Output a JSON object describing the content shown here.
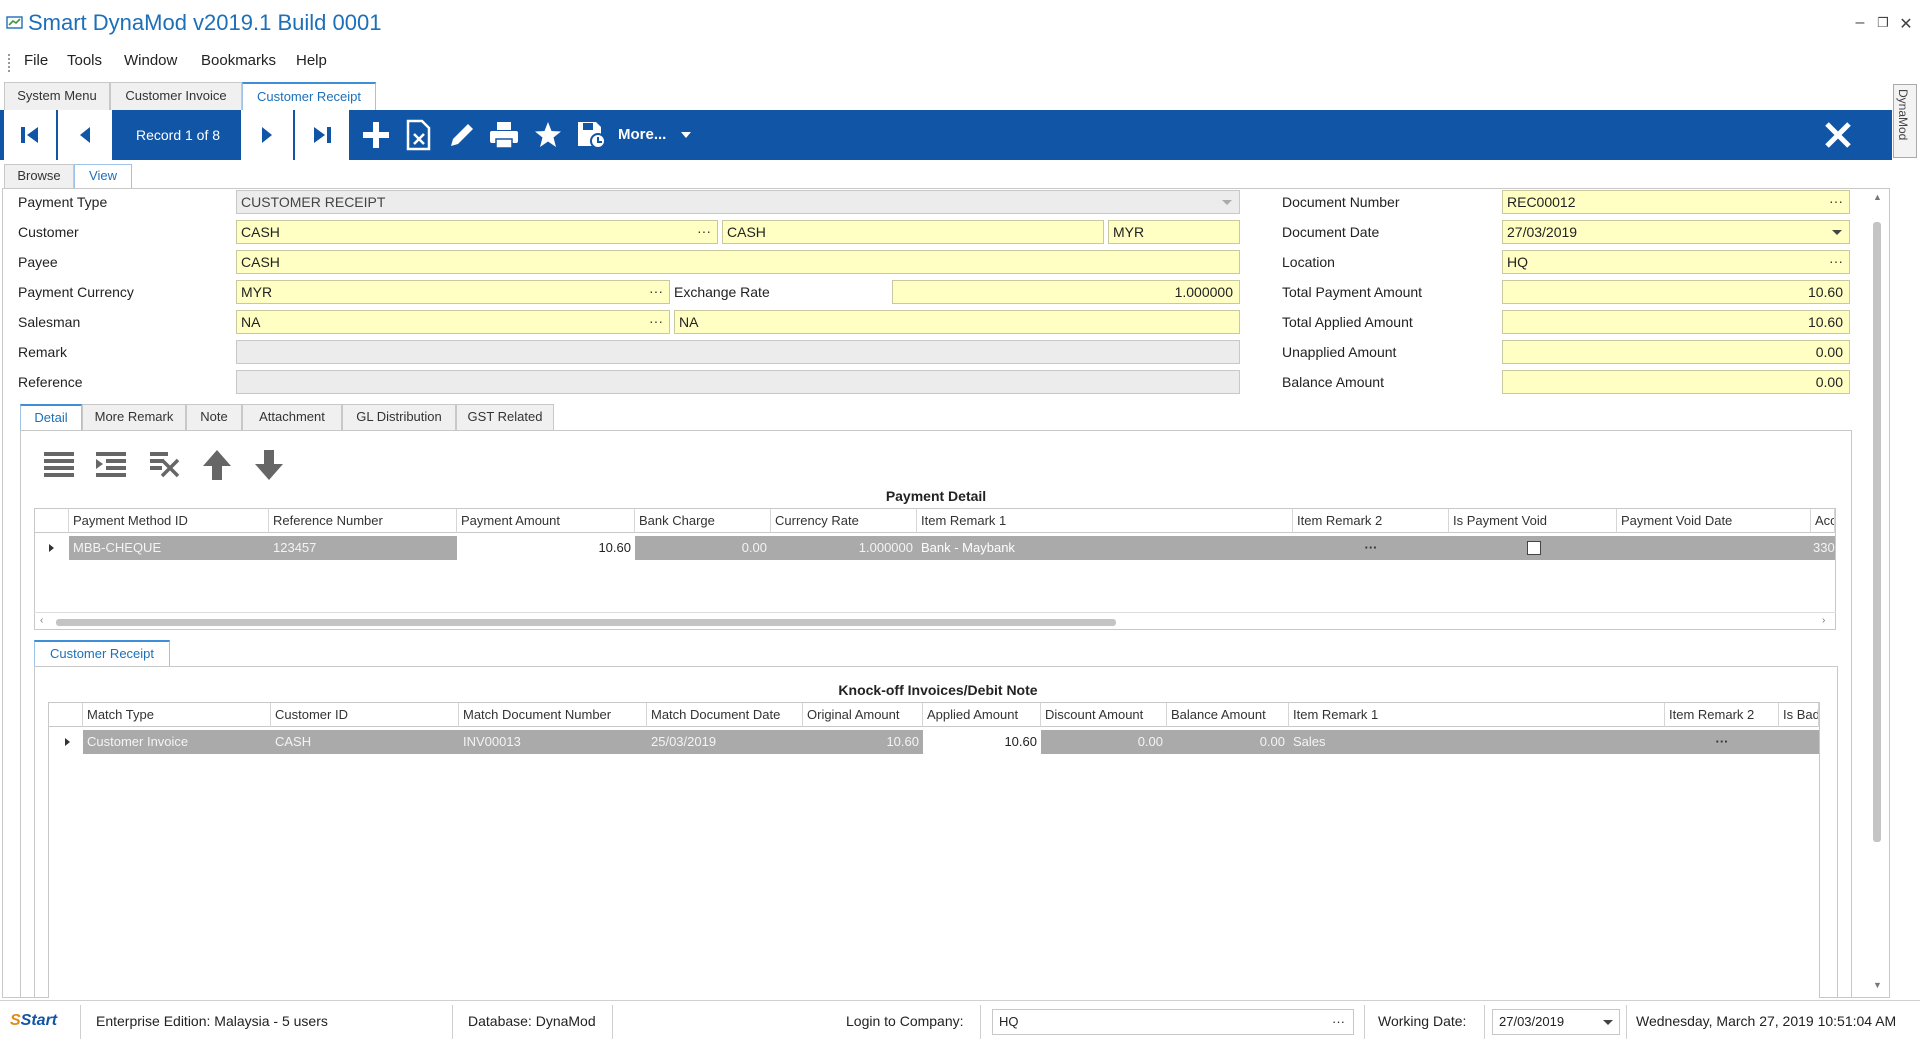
{
  "app": {
    "title": "Smart DynaMod v2019.1 Build 0001",
    "window_controls": [
      "–",
      "❐",
      "✕"
    ]
  },
  "menu": [
    "File",
    "Tools",
    "Window",
    "Bookmarks",
    "Help"
  ],
  "doc_tabs": [
    "System Menu",
    "Customer Invoice",
    "Customer Receipt"
  ],
  "side_tab": "DynaMod",
  "toolbar": {
    "record": "Record 1 of 8",
    "more": "More..."
  },
  "view_tabs": [
    "Browse",
    "View"
  ],
  "form": {
    "payment_type_label": "Payment Type",
    "payment_type": "CUSTOMER RECEIPT",
    "customer_label": "Customer",
    "customer_code": "CASH",
    "customer_name": "CASH",
    "customer_currency": "MYR",
    "payee_label": "Payee",
    "payee": "CASH",
    "payment_currency_label": "Payment Currency",
    "payment_currency": "MYR",
    "exchange_rate_label": "Exchange Rate",
    "exchange_rate": "1.000000",
    "salesman_label": "Salesman",
    "salesman_code": "NA",
    "salesman_name": "NA",
    "remark_label": "Remark",
    "remark": "",
    "reference_label": "Reference",
    "reference": "",
    "document_number_label": "Document Number",
    "document_number": "REC00012",
    "document_date_label": "Document Date",
    "document_date": "27/03/2019",
    "location_label": "Location",
    "location": "HQ",
    "total_payment_label": "Total Payment Amount",
    "total_payment": "10.60",
    "total_applied_label": "Total Applied Amount",
    "total_applied": "10.60",
    "unapplied_label": "Unapplied Amount",
    "unapplied": "0.00",
    "balance_label": "Balance Amount",
    "balance": "0.00"
  },
  "detail_tabs": [
    "Detail",
    "More Remark",
    "Note",
    "Attachment",
    "GL Distribution",
    "GST Related"
  ],
  "payment_detail": {
    "title": "Payment Detail",
    "columns": [
      "Payment Method ID",
      "Reference Number",
      "Payment Amount",
      "Bank Charge",
      "Currency Rate",
      "Item Remark 1",
      "Item Remark 2",
      "Is Payment Void",
      "Payment Void Date",
      "Acc"
    ],
    "row": {
      "payment_method_id": "MBB-CHEQUE",
      "reference_number": "123457",
      "payment_amount": "10.60",
      "bank_charge": "0.00",
      "currency_rate": "1.000000",
      "item_remark_1": "Bank - Maybank",
      "item_remark_2": "···",
      "acc": "330"
    }
  },
  "sub_tabs": [
    "Customer Receipt"
  ],
  "knockoff": {
    "title": "Knock-off Invoices/Debit Note",
    "columns": [
      "Match Type",
      "Customer ID",
      "Match Document Number",
      "Match Document Date",
      "Original Amount",
      "Applied Amount",
      "Discount Amount",
      "Balance Amount",
      "Item Remark 1",
      "Item Remark 2",
      "Is Bad"
    ],
    "row": {
      "match_type": "Customer Invoice",
      "customer_id": "CASH",
      "match_document_number": "INV00013",
      "match_document_date": "25/03/2019",
      "original_amount": "10.60",
      "applied_amount": "10.60",
      "discount_amount": "0.00",
      "balance_amount": "0.00",
      "item_remark_1": "Sales",
      "item_remark_2": "···"
    }
  },
  "status": {
    "logo": "Start",
    "edition": "Enterprise Edition: Malaysia - 5 users",
    "database": "Database: DynaMod",
    "login_label": "Login to Company:",
    "company": "HQ",
    "working_date_label": "Working Date:",
    "working_date": "27/03/2019",
    "datetime": "Wednesday, March 27, 2019 10:51:04 AM"
  },
  "colors": {
    "toolbar": "#1155a6",
    "accent": "#1d6fb8",
    "field_yellow": "#ffffc4",
    "row_gray": "#aaaaaa"
  }
}
